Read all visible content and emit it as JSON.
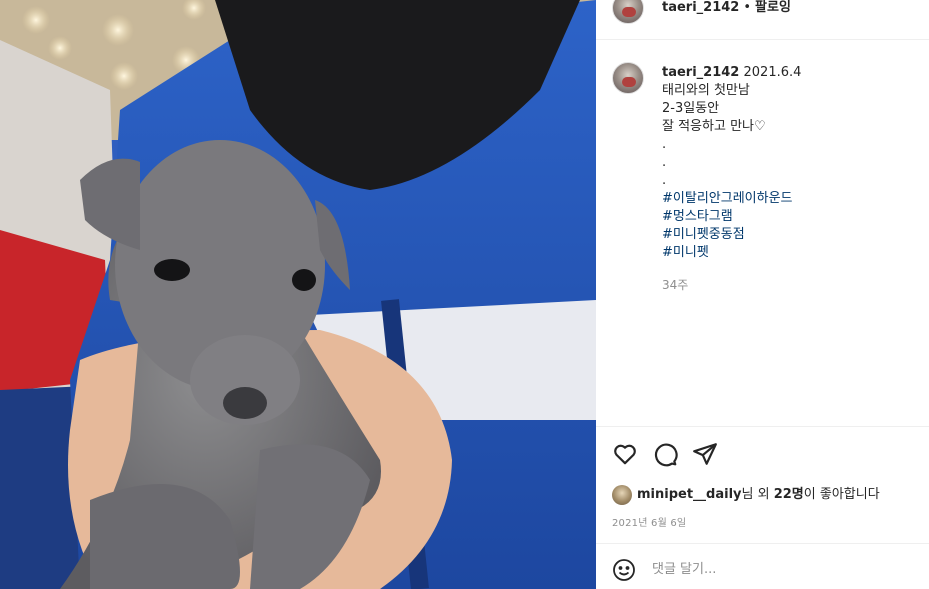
{
  "header": {
    "username": "taeri_2142",
    "separator": "•",
    "follow_label": "팔로잉"
  },
  "caption": {
    "username": "taeri_2142",
    "date": "2021.6.4",
    "lines": [
      "태리와의 첫만남",
      "2-3일동안",
      "잘 적응하고 만나♡",
      ".",
      ".",
      "."
    ],
    "hashtags": [
      "#이탈리안그레이하운드",
      "#멍스타그램",
      "#미니펫중동점",
      "#미니펫"
    ],
    "age": "34주"
  },
  "actions": {
    "like_icon": "heart-icon",
    "comment_icon": "comment-icon",
    "share_icon": "share-icon"
  },
  "likes": {
    "liker": "minipet__daily",
    "text_mid": "님 외 ",
    "count": "22명",
    "text_end": "이 좋아합니다"
  },
  "post_date": "2021년 6월 6일",
  "comment": {
    "emoji_icon": "smiley-icon",
    "placeholder": "댓글 달기..."
  },
  "colors": {
    "hashtag": "#00376b",
    "meta": "#8e8e8e",
    "text": "#262626"
  }
}
